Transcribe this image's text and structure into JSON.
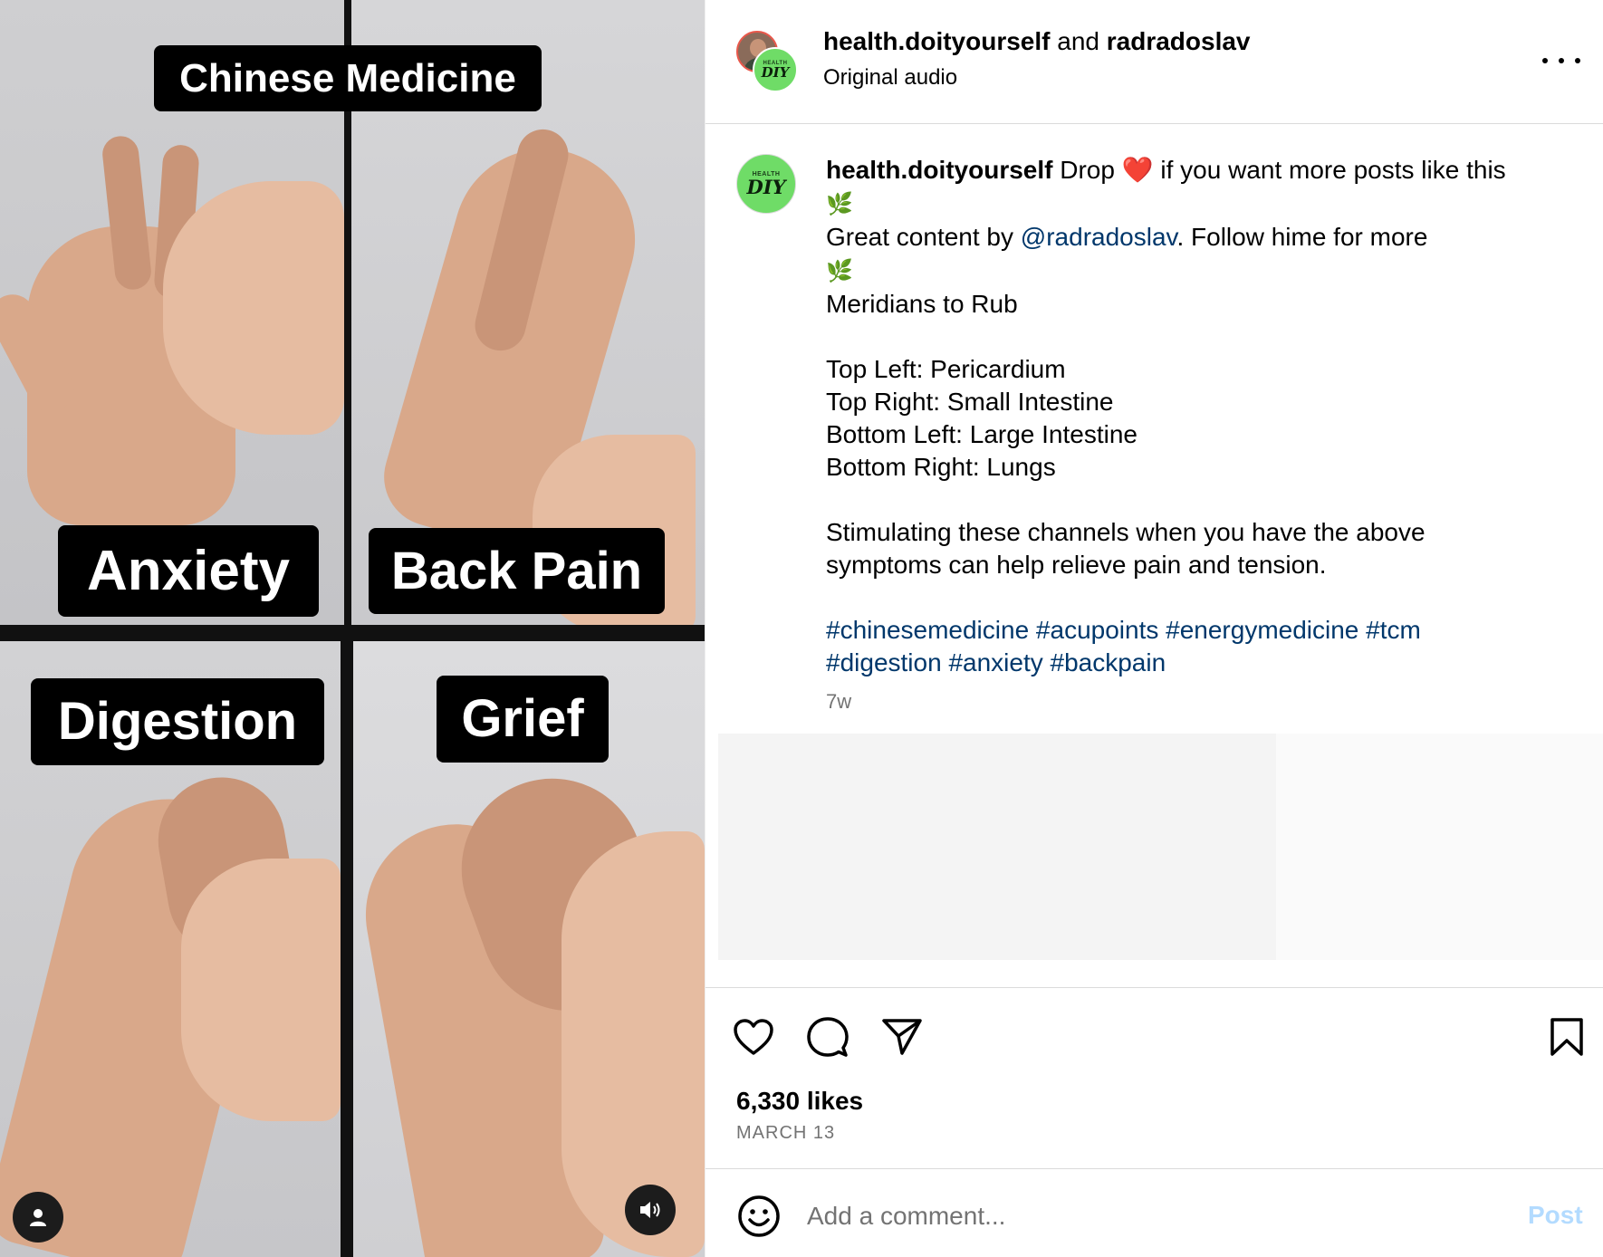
{
  "media": {
    "title": "Chinese Medicine",
    "panels": [
      "Anxiety",
      "Back Pain",
      "Digestion",
      "Grief"
    ]
  },
  "header": {
    "user1": "health.doityourself",
    "joiner": "and",
    "user2": "radradoslav",
    "audio": "Original audio",
    "avatar_badge_top": "HEALTH",
    "avatar_badge_main": "DIY"
  },
  "caption": {
    "username": "health.doityourself",
    "intro_before": "Drop",
    "heart": "❤️",
    "intro_after": "if you want more posts like this",
    "leaf": "🌿",
    "credit_before": "Great content by",
    "mention": "@radradoslav",
    "credit_after": ". Follow hime for more",
    "heading": "Meridians to Rub",
    "lines": [
      "Top Left: Pericardium",
      "Top Right: Small Intestine",
      "Bottom Left: Large Intestine",
      "Bottom Right: Lungs"
    ],
    "body_line1": "Stimulating these channels when you have the above",
    "body_line2": "symptoms can help relieve pain and tension.",
    "hashtags_line1": [
      "#chinesemedicine",
      "#acupoints",
      "#energymedicine",
      "#tcm"
    ],
    "hashtags_line2": [
      "#digestion",
      "#anxiety",
      "#backpain"
    ],
    "time_ago": "7w"
  },
  "stats": {
    "likes": "6,330 likes",
    "date": "MARCH 13"
  },
  "comment": {
    "placeholder": "Add a comment...",
    "post_label": "Post"
  },
  "icons": [
    "user-icon",
    "volume-icon",
    "more-icon",
    "heart-icon",
    "comment-icon",
    "share-icon",
    "bookmark-icon",
    "emoji-icon"
  ],
  "colors": {
    "link": "#00376b",
    "muted": "#737373",
    "post_disabled": "#b3dbff",
    "badge_green": "#6fdc67"
  }
}
